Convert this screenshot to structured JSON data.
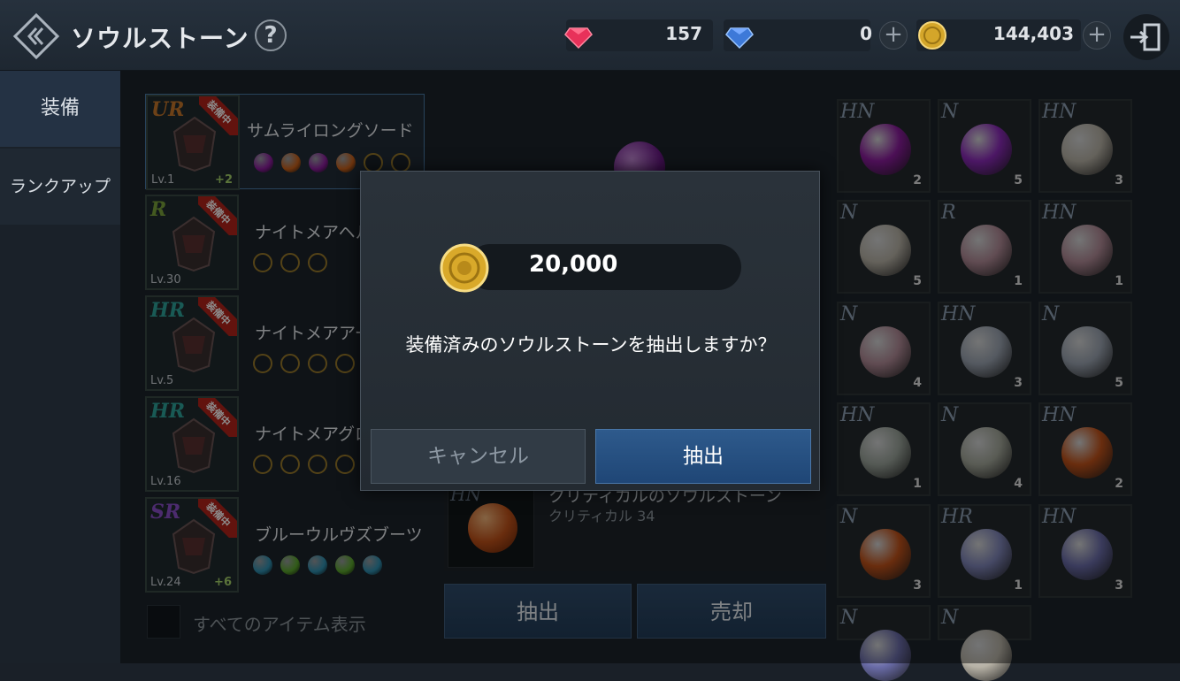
{
  "header": {
    "title": "ソウルストーン",
    "help": "?",
    "currencies": [
      {
        "icon": "ruby-gem-icon",
        "value": "157"
      },
      {
        "icon": "blue-diamond-icon",
        "value": "0"
      },
      {
        "icon": "gold-coin-icon",
        "value": "144,403"
      }
    ]
  },
  "sidebar": {
    "tabs": [
      {
        "label": "装備"
      },
      {
        "label": "ランクアップ"
      }
    ]
  },
  "equipment": [
    {
      "rarity": "UR",
      "rarity_color": "#c7772a",
      "badge": "装備中",
      "name": "サムライロングソード",
      "level": "Lv.1",
      "plus": "+2",
      "sockets": [
        "#8a1c9c",
        "#c8601a",
        "#8a1c9c",
        "#c8601a",
        "empty",
        "empty"
      ]
    },
    {
      "rarity": "R",
      "rarity_color": "#7ba23b",
      "badge": "装備中",
      "name": "ナイトメアヘルム",
      "level": "Lv.30",
      "plus": "",
      "sockets": [
        "empty",
        "empty",
        "empty"
      ]
    },
    {
      "rarity": "HR",
      "rarity_color": "#2fa59c",
      "badge": "装備中",
      "name": "ナイトメアアーマー",
      "level": "Lv.5",
      "plus": "",
      "sockets": [
        "empty",
        "empty",
        "empty",
        "empty"
      ]
    },
    {
      "rarity": "HR",
      "rarity_color": "#2fa59c",
      "badge": "装備中",
      "name": "ナイトメアグローブ",
      "level": "Lv.16",
      "plus": "",
      "sockets": [
        "empty",
        "empty",
        "empty",
        "empty"
      ]
    },
    {
      "rarity": "SR",
      "rarity_color": "#8a4fc9",
      "badge": "装備中",
      "name": "ブルーウルヴズブーツ",
      "level": "Lv.24",
      "plus": "+6",
      "sockets": [
        "#2e8fb0",
        "#5aa62c",
        "#2e8fb0",
        "#5aa62c",
        "#2e8fb0"
      ]
    }
  ],
  "show_all_label": "すべてのアイテム表示",
  "detail": {
    "rarity": "HN",
    "name": "クリティカルのソウルストーン",
    "stat": "クリティカル 34"
  },
  "actions": {
    "extract": "抽出",
    "sell": "売却"
  },
  "stones": [
    {
      "rarity": "HN",
      "color": "#8a1c9c",
      "count": "2"
    },
    {
      "rarity": "N",
      "color": "#8a2ab8",
      "count": "5"
    },
    {
      "rarity": "HN",
      "color": "#b7b2a6",
      "count": "3"
    },
    {
      "rarity": "N",
      "color": "#b7b2a6",
      "count": "5"
    },
    {
      "rarity": "R",
      "color": "#b08a96",
      "count": "1"
    },
    {
      "rarity": "HN",
      "color": "#b08a96",
      "count": "1"
    },
    {
      "rarity": "N",
      "color": "#b08a96",
      "count": "4"
    },
    {
      "rarity": "HN",
      "color": "#9aa3b0",
      "count": "3"
    },
    {
      "rarity": "N",
      "color": "#9aa3b0",
      "count": "5"
    },
    {
      "rarity": "HN",
      "color": "#9aa39a",
      "count": "1"
    },
    {
      "rarity": "N",
      "color": "#a3a79a",
      "count": "4"
    },
    {
      "rarity": "HN",
      "color": "#c0521a",
      "count": "2"
    },
    {
      "rarity": "N",
      "color": "#c0521a",
      "count": "3"
    },
    {
      "rarity": "HR",
      "color": "#7f85b8",
      "count": "1"
    },
    {
      "rarity": "HN",
      "color": "#6a6ca8",
      "count": "3"
    },
    {
      "rarity": "N",
      "color": "#6a6ca8",
      "count": ""
    },
    {
      "rarity": "N",
      "color": "#b7b2a6",
      "count": ""
    }
  ],
  "dialog": {
    "cost": "20,000",
    "message": "装備済みのソウルストーンを抽出しますか？",
    "cancel": "キャンセル",
    "confirm": "抽出"
  }
}
